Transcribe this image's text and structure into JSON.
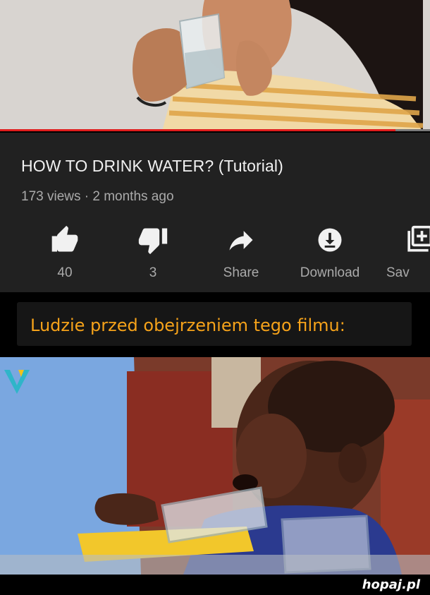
{
  "video": {
    "title": "HOW TO DRINK WATER? (Tutorial)",
    "meta": "173 views · 2 months ago",
    "progress_fraction": 0.92,
    "accent_color": "#e01e1e"
  },
  "actions": [
    {
      "icon": "thumbs-up-icon",
      "label": "40"
    },
    {
      "icon": "thumbs-down-icon",
      "label": "3"
    },
    {
      "icon": "share-arrow-icon",
      "label": "Share"
    },
    {
      "icon": "download-icon",
      "label": "Download"
    },
    {
      "icon": "add-to-playlist-icon",
      "label": "Sav"
    }
  ],
  "caption": {
    "text": "Ludzie przed obejrzeniem tego filmu:",
    "color": "#f5a21a"
  },
  "footer": {
    "watermark": "hopaj.pl"
  }
}
